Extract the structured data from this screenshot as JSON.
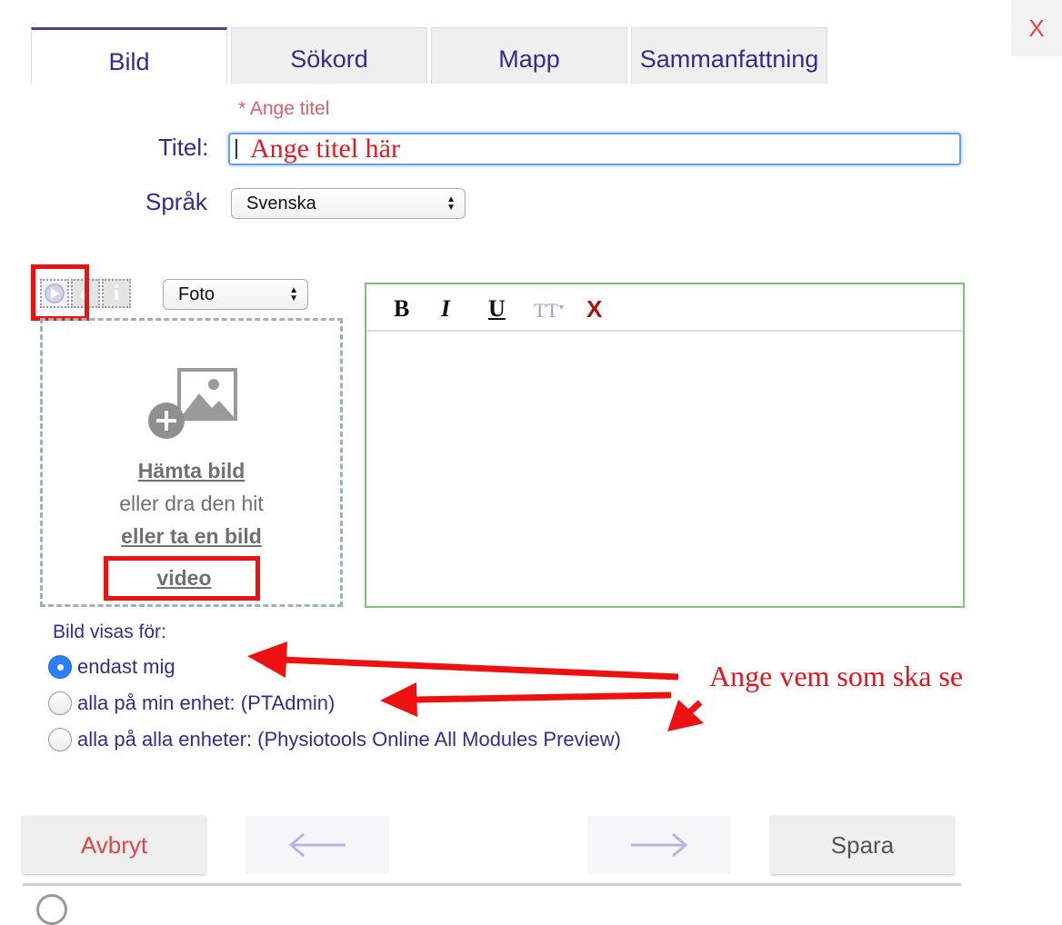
{
  "dialog": {
    "close_label": "X"
  },
  "tabs": [
    {
      "label": "Bild",
      "active": true
    },
    {
      "label": "Sökord",
      "active": false
    },
    {
      "label": "Mapp",
      "active": false
    },
    {
      "label": "Sammanfattning",
      "active": false
    }
  ],
  "form": {
    "required_hint": "* Ange titel",
    "title_label": "Titel:",
    "title_value": "Ange titel här",
    "language_label": "Språk",
    "language_value": "Svenska"
  },
  "media": {
    "type_value": "Foto",
    "icons": [
      "play-icon",
      "edit-icon",
      "info-icon"
    ],
    "dropzone": {
      "fetch_link": "Hämta bild",
      "drag_text": "eller dra den hit",
      "capture_link": "eller ta en bild",
      "video_link": "video"
    }
  },
  "editor": {
    "toolbar": {
      "bold": "B",
      "italic": "I",
      "underline": "U",
      "font_size": "TT",
      "clear": "X"
    },
    "content": ""
  },
  "visibility": {
    "label": "Bild visas för:",
    "options": [
      {
        "label": "endast mig",
        "selected": true
      },
      {
        "label": "alla på min enhet: (PTAdmin)",
        "selected": false
      },
      {
        "label": "alla på alla enheter: (Physiotools Online All Modules Preview)",
        "selected": false
      }
    ]
  },
  "annotation": {
    "text": "Ange vem som ska se",
    "color": "#e8141c"
  },
  "buttons": {
    "cancel": "Avbryt",
    "back": "←",
    "next": "→",
    "save": "Spara"
  },
  "colors": {
    "accent": "#332c8e",
    "cancel": "#e0474c",
    "annotation_red": "#ee1111",
    "selected_radio": "#2d7ef7"
  }
}
